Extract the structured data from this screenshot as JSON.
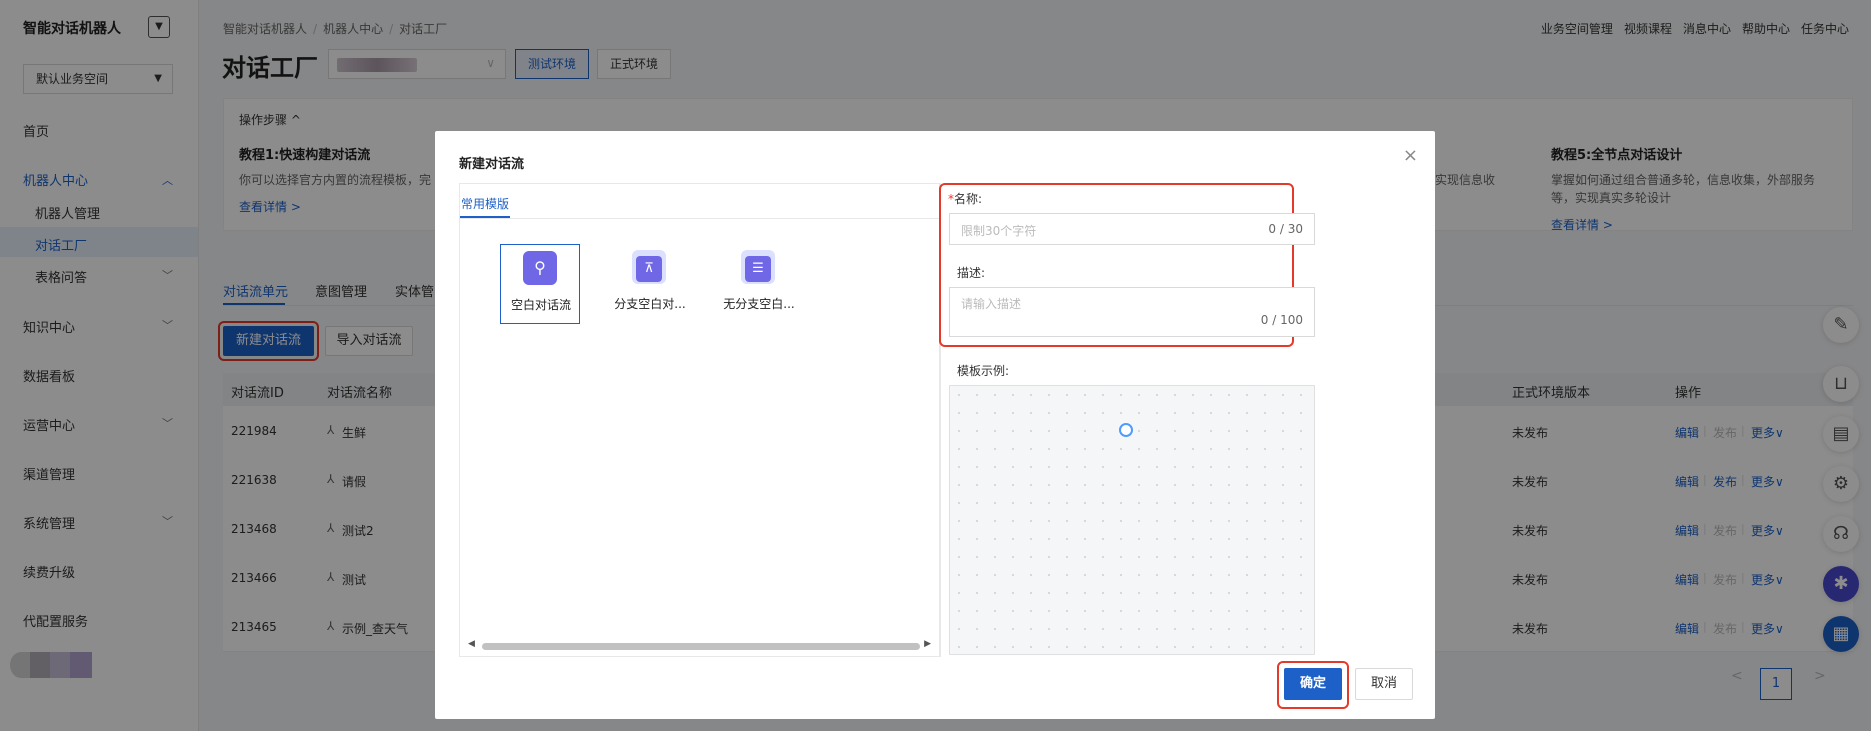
{
  "app": {
    "title": "智能对话机器人",
    "workspace": "默认业务空间"
  },
  "sidebar": {
    "items": [
      {
        "label": "首页"
      },
      {
        "label": "机器人中心"
      },
      {
        "label": "知识中心"
      },
      {
        "label": "数据看板"
      },
      {
        "label": "运营中心"
      },
      {
        "label": "渠道管理"
      },
      {
        "label": "系统管理"
      },
      {
        "label": "续费升级"
      },
      {
        "label": "代配置服务"
      }
    ],
    "sub_items": [
      {
        "label": "机器人管理"
      },
      {
        "label": "对话工厂"
      },
      {
        "label": "表格问答"
      }
    ]
  },
  "breadcrumb": [
    "智能对话机器人",
    "/",
    "机器人中心",
    "/",
    "对话工厂"
  ],
  "top_links": [
    "业务空间管理",
    "视频课程",
    "消息中心",
    "帮助中心",
    "任务中心"
  ],
  "page": {
    "title": "对话工厂",
    "env_test": "测试环境",
    "env_prod": "正式环境"
  },
  "steps": {
    "header": "操作步骤 ^",
    "tutorials": [
      {
        "title": "教程1:快速构建对话流",
        "desc": "你可以选择官方内置的流程模板，完",
        "link": "查看详情 >"
      },
      {
        "title": "教程5:全节点对话设计",
        "desc": "掌握如何通过组合普通多轮，信息收集，外部服务等，实现真实多轮设计",
        "link": "查看详情 >"
      }
    ],
    "fragment": "实现信息收"
  },
  "tabs": [
    "对话流单元",
    "意图管理",
    "实体管"
  ],
  "actions": {
    "new_flow": "新建对话流",
    "import_flow": "导入对话流"
  },
  "table": {
    "headers": {
      "id": "对话流ID",
      "name": "对话流名称",
      "prod_version": "正式环境版本",
      "ops": "操作"
    },
    "rows": [
      {
        "id": "221984",
        "name": "生鲜",
        "status": "未发布",
        "publish_enabled": false
      },
      {
        "id": "221638",
        "name": "请假",
        "status": "未发布",
        "publish_enabled": true
      },
      {
        "id": "213468",
        "name": "测试2",
        "status": "未发布",
        "publish_enabled": false
      },
      {
        "id": "213466",
        "name": "测试",
        "status": "未发布",
        "publish_enabled": false
      },
      {
        "id": "213465",
        "name": "示例_查天气",
        "status": "未发布",
        "publish_enabled": false
      }
    ],
    "op_edit": "编辑",
    "op_publish": "发布",
    "op_more": "更多∨"
  },
  "pagination": {
    "current": "1",
    "prev": "<",
    "next": ">"
  },
  "modal": {
    "title": "新建对话流",
    "close": "×",
    "template_tab": "常用模版",
    "templates": [
      {
        "label": "空白对话流",
        "icon": "pin-icon"
      },
      {
        "label": "分支空白对...",
        "icon": "branch-icon"
      },
      {
        "label": "无分支空白...",
        "icon": "list-icon"
      }
    ],
    "name_label": "名称:",
    "name_required": "*",
    "name_placeholder": "限制30个字符",
    "name_count": "0 / 30",
    "desc_label": "描述:",
    "desc_placeholder": "请输入描述",
    "desc_count": "0 / 100",
    "preview_label": "模板示例:",
    "confirm": "确定",
    "cancel": "取消"
  },
  "colors": {
    "primary": "#1d61c8",
    "highlight_red": "#e53a2a",
    "template_purple": "#7067e6"
  }
}
